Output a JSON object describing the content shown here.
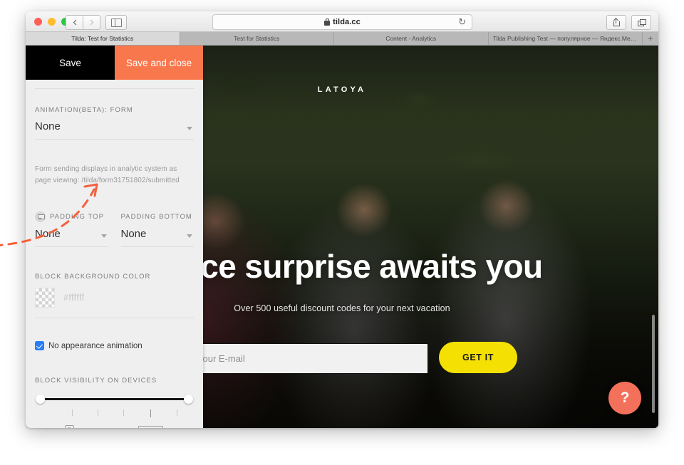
{
  "browser": {
    "url": "tilda.cc",
    "lock_icon": "lock-icon",
    "reload_icon": "reload-icon",
    "back_icon": "chevron-left-icon",
    "forward_icon": "chevron-right-icon",
    "sidebar_icon": "sidebar-toggle-icon",
    "share_icon": "share-icon",
    "tabs_overview_icon": "tabs-overview-icon",
    "new_tab_label": "+",
    "tabs": [
      {
        "label": "Tilda: Test for Statistics",
        "active": true
      },
      {
        "label": "Test for Statistics",
        "active": false
      },
      {
        "label": "Content - Analytics",
        "active": false
      },
      {
        "label": "Tilda Publishing Test — популярное — Яндекс.Мет…",
        "active": false
      }
    ]
  },
  "panel": {
    "save_label": "Save",
    "save_and_close_label": "Save and close",
    "animation": {
      "label": "ANIMATION(BETA): FORM",
      "value": "None"
    },
    "note": "Form sending displays in analytic system as page viewing: /tilda/form31751802/submitted",
    "padding_top": {
      "label": "PADDING TOP",
      "value": "None",
      "icon": "desktop-monitor-icon"
    },
    "padding_bottom": {
      "label": "PADDING BOTTOM",
      "value": "None"
    },
    "background_color": {
      "label": "BLOCK BACKGROUND COLOR",
      "placeholder": "#ffffff",
      "swatch": "transparent-checkerboard"
    },
    "no_animation_checkbox": {
      "label": "No appearance animation",
      "checked": true
    },
    "visibility": {
      "label": "BLOCK VISIBILITY ON DEVICES",
      "mobile_icon": "phone-icon",
      "desktop_icon": "laptop-icon"
    }
  },
  "preview": {
    "brand": "LATOYA",
    "headline": "A nice surprise awaits you",
    "subline": "Over 500 useful discount codes for your next vacation",
    "email_placeholder": "Your E-mail",
    "submit_label": "GET IT",
    "help_label": "?",
    "help_color": "#f3705a",
    "submit_color": "#f5e003"
  },
  "annotation": {
    "color": "#f4603e",
    "target": "/tilda/form31751802/submitted"
  }
}
